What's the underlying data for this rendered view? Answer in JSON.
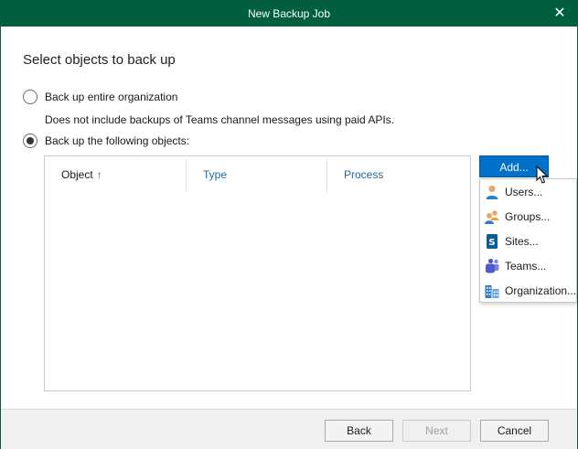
{
  "window": {
    "title": "New Backup Job",
    "close_glyph": "✕"
  },
  "page": {
    "heading": "Select objects to back up"
  },
  "options": {
    "entire_org": {
      "label": "Back up entire organization",
      "checked": false,
      "note": "Does not include backups of Teams channel messages using paid APIs."
    },
    "following": {
      "label": "Back up the following objects:",
      "checked": true
    }
  },
  "table": {
    "columns": [
      {
        "label": "Object",
        "sort": "ascending",
        "sort_glyph": "↑"
      },
      {
        "label": "Type"
      },
      {
        "label": "Process"
      }
    ],
    "rows": []
  },
  "add_button": {
    "label": "Add..."
  },
  "add_menu": {
    "items": [
      {
        "label": "Users...",
        "icon": "user-icon"
      },
      {
        "label": "Groups...",
        "icon": "group-icon"
      },
      {
        "label": "Sites...",
        "icon": "sharepoint-site-icon"
      },
      {
        "label": "Teams...",
        "icon": "teams-icon"
      },
      {
        "label": "Organization...",
        "icon": "organization-icon"
      }
    ]
  },
  "footer": {
    "back_label": "Back",
    "next_label": "Next",
    "next_enabled": false,
    "cancel_label": "Cancel"
  },
  "colors": {
    "titlebar": "#005f3f",
    "accent_button": "#0070c9",
    "link_header": "#1f6aa5"
  }
}
